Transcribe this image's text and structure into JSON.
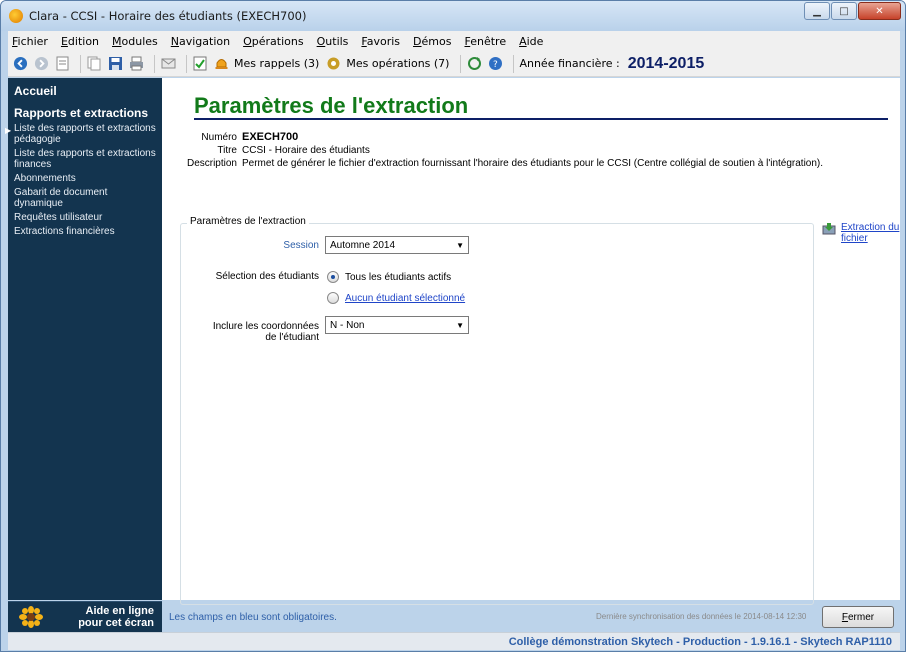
{
  "window": {
    "title": "Clara - CCSI - Horaire des étudiants (EXECH700)"
  },
  "menu": [
    "Fichier",
    "Edition",
    "Modules",
    "Navigation",
    "Opérations",
    "Outils",
    "Favoris",
    "Démos",
    "Fenêtre",
    "Aide"
  ],
  "toolbar": {
    "reminders": "Mes rappels (3)",
    "operations": "Mes opérations (7)",
    "year_label": "Année financière :",
    "year_value": "2014-2015"
  },
  "sidebar": {
    "home": "Accueil",
    "section": "Rapports et extractions",
    "items": [
      "Liste des rapports et extractions pédagogie",
      "Liste des rapports et extractions finances",
      "Abonnements",
      "Gabarit de document dynamique",
      "Requêtes utilisateur",
      "Extractions financières"
    ],
    "help": "Aide en ligne pour cet écran"
  },
  "page": {
    "title": "Paramètres de l'extraction",
    "numero_label": "Numéro",
    "numero_value": "EXECH700",
    "titre_label": "Titre",
    "titre_value": "CCSI - Horaire des étudiants",
    "description_label": "Description",
    "description_value": "Permet de générer le fichier d'extraction fournissant l'horaire des étudiants pour le CCSI (Centre collégial de soutien à l'intégration)."
  },
  "form": {
    "group_title": "Paramètres de l'extraction",
    "session_label": "Session",
    "session_value": "Automne 2014",
    "students_label": "Sélection des étudiants",
    "radio_all": "Tous les étudiants actifs",
    "radio_none": "Aucun étudiant sélectionné",
    "coords_label": "Inclure les coordonnées de l'étudiant",
    "coords_value": "N - Non"
  },
  "actions": {
    "extract_link": "Extraction du fichier",
    "close_button": "Fermer"
  },
  "footer": {
    "required_note": "Les champs en bleu sont obligatoires.",
    "sync": "Dernière synchronisation des données le 2014-08-14 12:30"
  },
  "status": "Collège démonstration Skytech - Production - 1.9.16.1 - Skytech  RAP1110"
}
